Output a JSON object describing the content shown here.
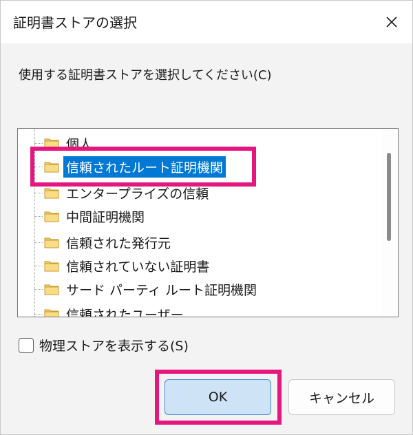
{
  "window": {
    "title": "証明書ストアの選択",
    "close_icon": "close-icon"
  },
  "instruction": "使用する証明書ストアを選択してください(C)",
  "tree": {
    "selected_index": 1,
    "items": [
      {
        "label": "個人",
        "icon": "folder-icon"
      },
      {
        "label": "信頼されたルート証明機関",
        "icon": "folder-icon"
      },
      {
        "label": "エンタープライズの信頼",
        "icon": "folder-icon"
      },
      {
        "label": "中間証明機関",
        "icon": "folder-icon"
      },
      {
        "label": "信頼された発行元",
        "icon": "folder-icon"
      },
      {
        "label": "信頼されていない証明書",
        "icon": "folder-icon"
      },
      {
        "label": "サード パーティ ルート証明機関",
        "icon": "folder-icon"
      },
      {
        "label": "信頼されたユーザー",
        "icon": "folder-icon"
      }
    ]
  },
  "show_physical": {
    "label": "物理ストアを表示する(S)",
    "checked": false
  },
  "buttons": {
    "ok": "OK",
    "cancel": "キャンセル"
  },
  "colors": {
    "selection": "#0078d4",
    "annotation": "#e5177e",
    "ok_fill": "#cfe3f7"
  }
}
